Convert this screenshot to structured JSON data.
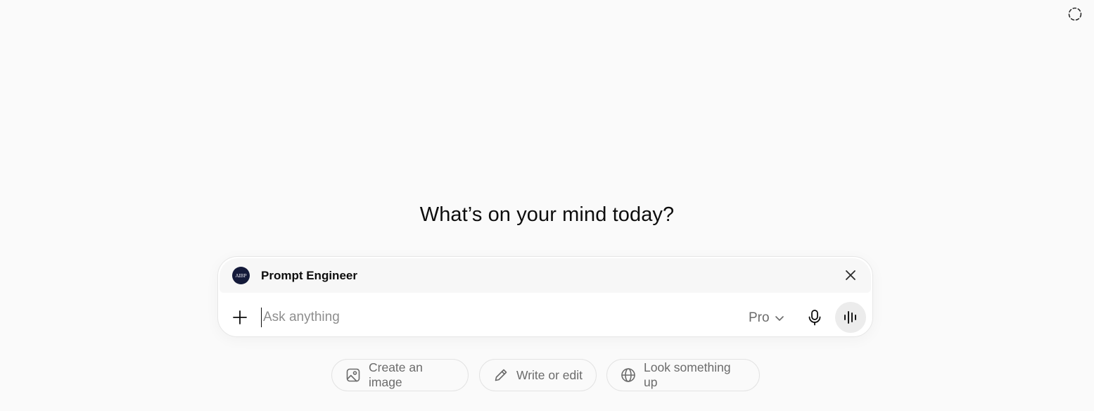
{
  "headline": "What’s on your mind today?",
  "gpt": {
    "avatar_text": "AIBP",
    "name": "Prompt Engineer",
    "close_icon": "close-icon"
  },
  "composer": {
    "placeholder": "Ask anything",
    "value": "",
    "model_label": "Pro",
    "icons": [
      "plus-icon",
      "chevron-down-icon",
      "microphone-icon",
      "voice-waveform-icon"
    ]
  },
  "suggestions": [
    {
      "label": "Create an image",
      "icon": "image-icon"
    },
    {
      "label": "Write or edit",
      "icon": "pencil-icon"
    },
    {
      "label": "Look something up",
      "icon": "globe-icon"
    }
  ],
  "colors": {
    "background": "#fafafa",
    "text": "#0d0d0d",
    "muted": "#6b6b6b",
    "placeholder": "#8e8e8e",
    "avatar_bg": "#141a3a",
    "voice_button_bg": "#ececec"
  }
}
